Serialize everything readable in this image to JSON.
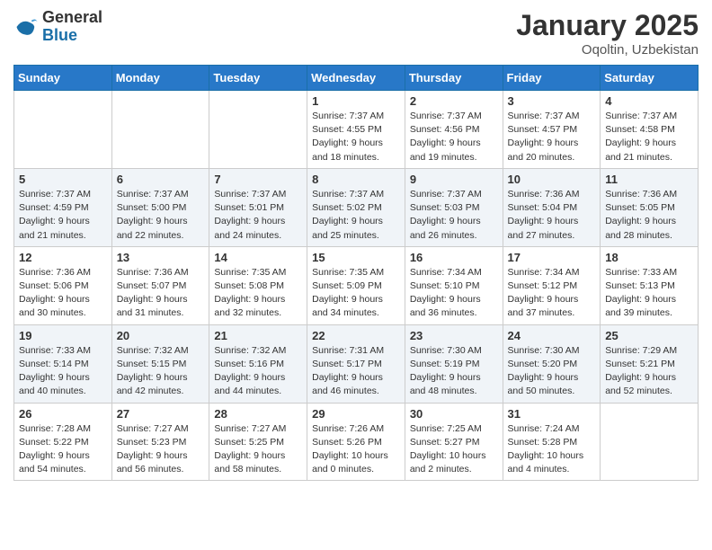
{
  "logo": {
    "general": "General",
    "blue": "Blue"
  },
  "title": "January 2025",
  "location": "Oqoltin, Uzbekistan",
  "days_of_week": [
    "Sunday",
    "Monday",
    "Tuesday",
    "Wednesday",
    "Thursday",
    "Friday",
    "Saturday"
  ],
  "weeks": [
    [
      {
        "day": "",
        "info": ""
      },
      {
        "day": "",
        "info": ""
      },
      {
        "day": "",
        "info": ""
      },
      {
        "day": "1",
        "info": "Sunrise: 7:37 AM\nSunset: 4:55 PM\nDaylight: 9 hours\nand 18 minutes."
      },
      {
        "day": "2",
        "info": "Sunrise: 7:37 AM\nSunset: 4:56 PM\nDaylight: 9 hours\nand 19 minutes."
      },
      {
        "day": "3",
        "info": "Sunrise: 7:37 AM\nSunset: 4:57 PM\nDaylight: 9 hours\nand 20 minutes."
      },
      {
        "day": "4",
        "info": "Sunrise: 7:37 AM\nSunset: 4:58 PM\nDaylight: 9 hours\nand 21 minutes."
      }
    ],
    [
      {
        "day": "5",
        "info": "Sunrise: 7:37 AM\nSunset: 4:59 PM\nDaylight: 9 hours\nand 21 minutes."
      },
      {
        "day": "6",
        "info": "Sunrise: 7:37 AM\nSunset: 5:00 PM\nDaylight: 9 hours\nand 22 minutes."
      },
      {
        "day": "7",
        "info": "Sunrise: 7:37 AM\nSunset: 5:01 PM\nDaylight: 9 hours\nand 24 minutes."
      },
      {
        "day": "8",
        "info": "Sunrise: 7:37 AM\nSunset: 5:02 PM\nDaylight: 9 hours\nand 25 minutes."
      },
      {
        "day": "9",
        "info": "Sunrise: 7:37 AM\nSunset: 5:03 PM\nDaylight: 9 hours\nand 26 minutes."
      },
      {
        "day": "10",
        "info": "Sunrise: 7:36 AM\nSunset: 5:04 PM\nDaylight: 9 hours\nand 27 minutes."
      },
      {
        "day": "11",
        "info": "Sunrise: 7:36 AM\nSunset: 5:05 PM\nDaylight: 9 hours\nand 28 minutes."
      }
    ],
    [
      {
        "day": "12",
        "info": "Sunrise: 7:36 AM\nSunset: 5:06 PM\nDaylight: 9 hours\nand 30 minutes."
      },
      {
        "day": "13",
        "info": "Sunrise: 7:36 AM\nSunset: 5:07 PM\nDaylight: 9 hours\nand 31 minutes."
      },
      {
        "day": "14",
        "info": "Sunrise: 7:35 AM\nSunset: 5:08 PM\nDaylight: 9 hours\nand 32 minutes."
      },
      {
        "day": "15",
        "info": "Sunrise: 7:35 AM\nSunset: 5:09 PM\nDaylight: 9 hours\nand 34 minutes."
      },
      {
        "day": "16",
        "info": "Sunrise: 7:34 AM\nSunset: 5:10 PM\nDaylight: 9 hours\nand 36 minutes."
      },
      {
        "day": "17",
        "info": "Sunrise: 7:34 AM\nSunset: 5:12 PM\nDaylight: 9 hours\nand 37 minutes."
      },
      {
        "day": "18",
        "info": "Sunrise: 7:33 AM\nSunset: 5:13 PM\nDaylight: 9 hours\nand 39 minutes."
      }
    ],
    [
      {
        "day": "19",
        "info": "Sunrise: 7:33 AM\nSunset: 5:14 PM\nDaylight: 9 hours\nand 40 minutes."
      },
      {
        "day": "20",
        "info": "Sunrise: 7:32 AM\nSunset: 5:15 PM\nDaylight: 9 hours\nand 42 minutes."
      },
      {
        "day": "21",
        "info": "Sunrise: 7:32 AM\nSunset: 5:16 PM\nDaylight: 9 hours\nand 44 minutes."
      },
      {
        "day": "22",
        "info": "Sunrise: 7:31 AM\nSunset: 5:17 PM\nDaylight: 9 hours\nand 46 minutes."
      },
      {
        "day": "23",
        "info": "Sunrise: 7:30 AM\nSunset: 5:19 PM\nDaylight: 9 hours\nand 48 minutes."
      },
      {
        "day": "24",
        "info": "Sunrise: 7:30 AM\nSunset: 5:20 PM\nDaylight: 9 hours\nand 50 minutes."
      },
      {
        "day": "25",
        "info": "Sunrise: 7:29 AM\nSunset: 5:21 PM\nDaylight: 9 hours\nand 52 minutes."
      }
    ],
    [
      {
        "day": "26",
        "info": "Sunrise: 7:28 AM\nSunset: 5:22 PM\nDaylight: 9 hours\nand 54 minutes."
      },
      {
        "day": "27",
        "info": "Sunrise: 7:27 AM\nSunset: 5:23 PM\nDaylight: 9 hours\nand 56 minutes."
      },
      {
        "day": "28",
        "info": "Sunrise: 7:27 AM\nSunset: 5:25 PM\nDaylight: 9 hours\nand 58 minutes."
      },
      {
        "day": "29",
        "info": "Sunrise: 7:26 AM\nSunset: 5:26 PM\nDaylight: 10 hours\nand 0 minutes."
      },
      {
        "day": "30",
        "info": "Sunrise: 7:25 AM\nSunset: 5:27 PM\nDaylight: 10 hours\nand 2 minutes."
      },
      {
        "day": "31",
        "info": "Sunrise: 7:24 AM\nSunset: 5:28 PM\nDaylight: 10 hours\nand 4 minutes."
      },
      {
        "day": "",
        "info": ""
      }
    ]
  ]
}
